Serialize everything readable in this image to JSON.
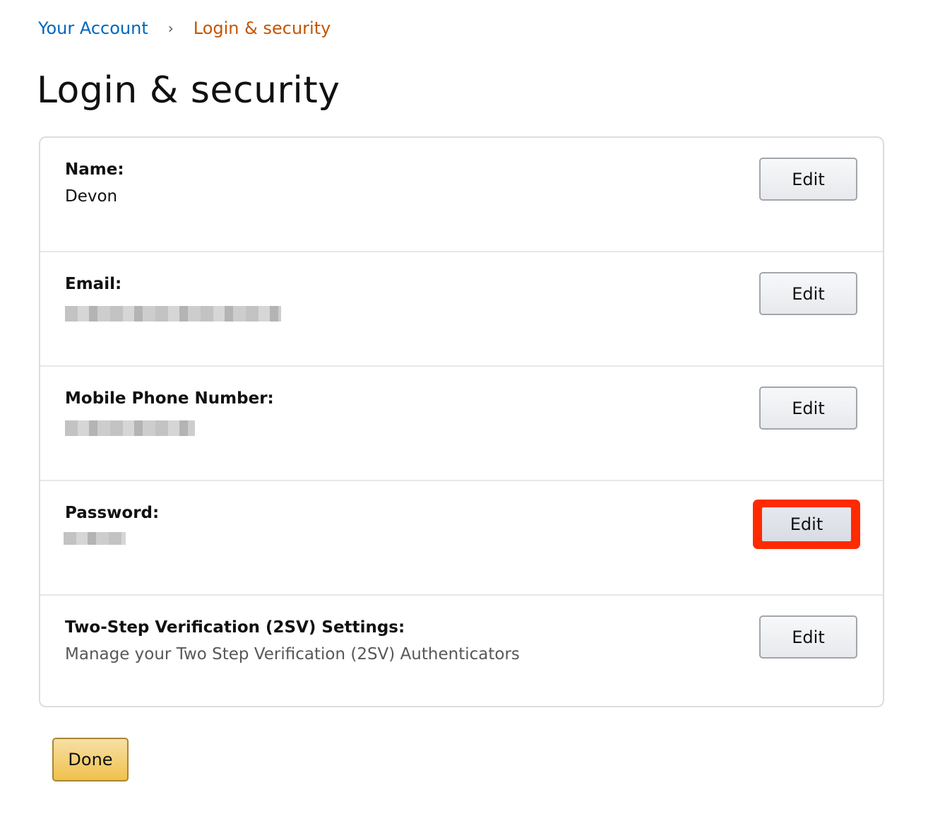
{
  "breadcrumb": {
    "items": [
      {
        "label": "Your Account"
      },
      {
        "label": "Login & security"
      }
    ],
    "separator": "›"
  },
  "page": {
    "title": "Login & security"
  },
  "colors": {
    "link": "#0066c0",
    "current_crumb": "#c45500",
    "highlight": "#ff2a00",
    "done_button": "#f0c14b"
  },
  "sections": [
    {
      "label": "Name:",
      "value": "Devon",
      "value_redacted": false,
      "edit_label": "Edit"
    },
    {
      "label": "Email:",
      "value": null,
      "value_redacted": true,
      "edit_label": "Edit"
    },
    {
      "label": "Mobile Phone Number:",
      "value": null,
      "value_redacted": true,
      "edit_label": "Edit"
    },
    {
      "label": "Password:",
      "value": null,
      "value_redacted": true,
      "edit_label": "Edit",
      "highlighted": true
    },
    {
      "label": "Two-Step Verification (2SV) Settings:",
      "value": "Manage your Two Step Verification (2SV) Authenticators",
      "value_redacted": false,
      "edit_label": "Edit"
    }
  ],
  "footer": {
    "done_label": "Done"
  }
}
